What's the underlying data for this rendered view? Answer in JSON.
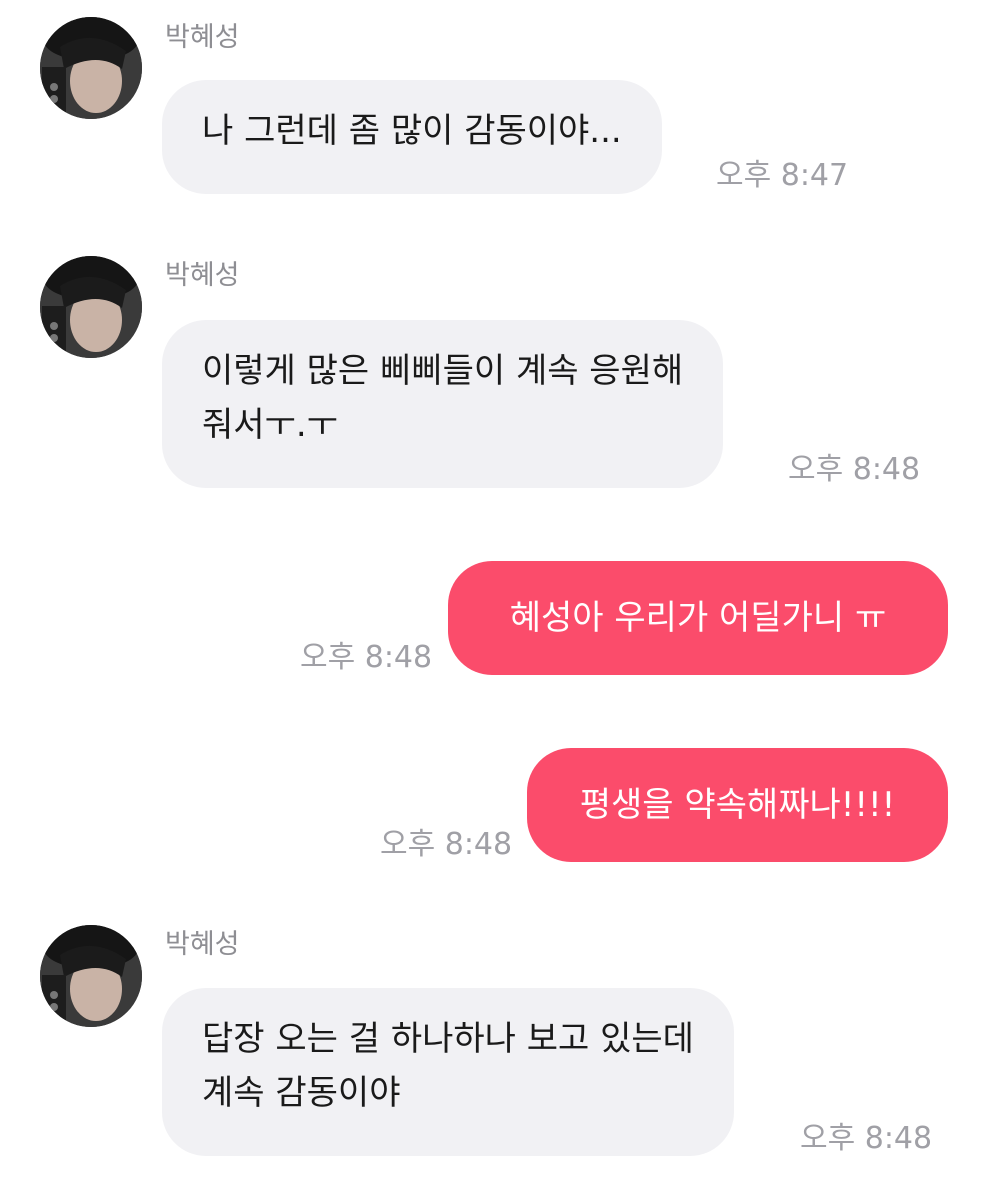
{
  "messages": [
    {
      "direction": "incoming",
      "sender": "박혜성",
      "avatar_icon": "profile-photo",
      "text": "나 그런데 좀 많이 감동이야...",
      "time": "오후 8:47"
    },
    {
      "direction": "incoming",
      "sender": "박혜성",
      "avatar_icon": "profile-photo",
      "text": "이렇게 많은 삐삐들이 계속 응원해\n줘서ㅜ.ㅜ",
      "time": "오후 8:48"
    },
    {
      "direction": "outgoing",
      "text": "혜성아 우리가 어딜가니 ㅠ",
      "time": "오후 8:48"
    },
    {
      "direction": "outgoing",
      "text": "평생을 약속해짜나!!!!",
      "time": "오후 8:48"
    },
    {
      "direction": "incoming",
      "sender": "박혜성",
      "avatar_icon": "profile-photo",
      "text": "답장 오는 걸 하나하나 보고 있는데\n계속 감동이야",
      "time": "오후 8:48"
    }
  ],
  "colors": {
    "incoming_bubble": "#f1f1f4",
    "outgoing_bubble": "#fb4c6b",
    "timestamp": "#a0a0a6",
    "sender_name": "#8e8e93"
  }
}
